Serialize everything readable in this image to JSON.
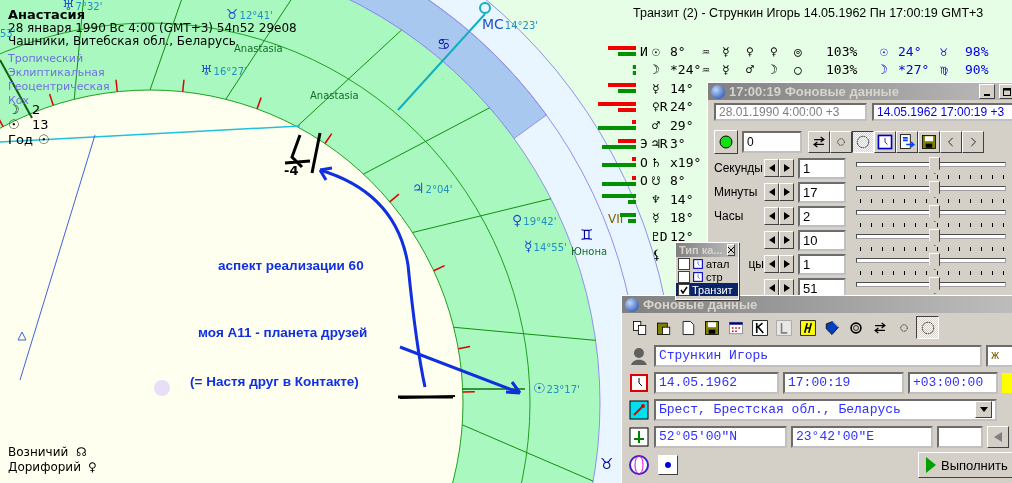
{
  "chart": {
    "header": {
      "name": "Анастасия",
      "date_line": "28 января 1990  Вс   4:00 (GMT+3) 54n52  29e08",
      "place": "Чашники, Витебская обл., Беларусь"
    },
    "settings": [
      "Тропический",
      "Эклиптикальная",
      "Геоцентрическая",
      "Кох"
    ],
    "indicators": [
      {
        "symbol": "☽",
        "value": "2"
      },
      {
        "symbol": "☉",
        "value": "13"
      },
      {
        "symbol": "Год",
        "value": "☉"
      }
    ],
    "labels": [
      {
        "kind": "degree",
        "text": "53'"
      },
      {
        "kind": "planet",
        "symbol": "♅",
        "text": "7°32'"
      },
      {
        "kind": "planet",
        "symbol": "♉",
        "text": "12°41'"
      },
      {
        "kind": "planet",
        "symbol": "♅",
        "text": "16°27'"
      },
      {
        "kind": "name",
        "text": "Anastasia"
      },
      {
        "kind": "name",
        "text": "Anastasia"
      },
      {
        "kind": "planet",
        "symbol": "MC",
        "text": "14°23'"
      },
      {
        "kind": "sign",
        "symbol": "♋"
      },
      {
        "kind": "planet",
        "symbol": "♃",
        "text": "2°04'"
      },
      {
        "kind": "planet",
        "symbol": "♀",
        "text": "19°42'"
      },
      {
        "kind": "planet",
        "symbol": "☿",
        "text": "14°55'"
      },
      {
        "kind": "sign",
        "symbol": "♊"
      },
      {
        "kind": "name",
        "text": "Юнона"
      },
      {
        "kind": "planet",
        "symbol": "☉",
        "text": "23°17'"
      },
      {
        "kind": "sign",
        "symbol": "♉"
      },
      {
        "kind": "house",
        "text": "VII"
      }
    ],
    "stars": [
      {
        "name": "Возничий",
        "symbol": "☊"
      },
      {
        "name": "Дорифорий",
        "symbol": "♀"
      }
    ],
    "annotations": [
      "аспект реализации 60",
      "моя А11 - планета друзей",
      "(= Настя  друг в Контакте)",
      "-4"
    ]
  },
  "transit": {
    "title": "Транзит (2) - Стрункин Игорь 14.05.1962  Пн 17:00:19 GMT+3",
    "rows": [
      {
        "bars": [
          {
            "kind": "red",
            "level": 0.7
          },
          {
            "kind": "green",
            "level": 0.45
          }
        ],
        "cells": [
          "И",
          "☉",
          "8°",
          "♒",
          "☿",
          "♀",
          "♀",
          "◎",
          "103%",
          "☉",
          "24°",
          "♉",
          "98%"
        ]
      },
      {
        "bars": [
          {
            "kind": "green",
            "level": 0.08
          },
          {
            "kind": "green",
            "level": 0.08
          }
        ],
        "cells": [
          "",
          "☽",
          "*24°",
          "♒",
          "☿",
          "♂",
          "☽",
          "○",
          "103%",
          "☽",
          "*27°",
          "♍",
          "90%"
        ]
      },
      {
        "bars": [
          {
            "kind": "red",
            "level": 0.7
          },
          {
            "kind": "green",
            "level": 0.45
          }
        ],
        "cells": [
          "",
          "☿",
          "14°"
        ]
      },
      {
        "bars": [
          {
            "kind": "red",
            "level": 0.95
          },
          {
            "kind": "red",
            "level": 0.45
          }
        ],
        "cells": [
          "",
          "♀R",
          "24°"
        ]
      },
      {
        "bars": [
          {
            "kind": "red",
            "level": 0.1
          },
          {
            "kind": "green",
            "level": 0.95
          }
        ],
        "cells": [
          "",
          "♂",
          "29°"
        ]
      },
      {
        "bars": [
          {
            "kind": "red",
            "level": 0.45
          },
          {
            "kind": "green",
            "level": 0.85
          }
        ],
        "cells": [
          "Э",
          "♃R",
          "3°"
        ]
      },
      {
        "bars": [
          {
            "kind": "red",
            "level": 0.1
          },
          {
            "kind": "green",
            "level": 0.85
          }
        ],
        "cells": [
          "О",
          "♄",
          "x19°"
        ]
      },
      {
        "bars": [
          {
            "kind": "red",
            "level": 0.1
          },
          {
            "kind": "green",
            "level": 0.85
          }
        ],
        "cells": [
          "О",
          "☋",
          "8°"
        ]
      },
      {
        "bars": [
          {
            "kind": "green",
            "level": 0.85
          },
          {
            "kind": "green",
            "level": 0.2
          }
        ],
        "cells": [
          "",
          "♆",
          "14°"
        ]
      },
      {
        "bars": [
          {
            "kind": "green",
            "level": 0.4
          },
          {
            "kind": "green",
            "level": 0.2
          }
        ],
        "cells": [
          "",
          "☿",
          "18°"
        ]
      },
      {
        "bars": [],
        "cells": [
          "",
          "♇D",
          "12°"
        ]
      },
      {
        "bars": [],
        "cells": [
          "",
          "⚸"
        ]
      }
    ]
  },
  "window_timer": {
    "title": "17:00:19 Фоновые данные",
    "date_natal": "28.01.1990   4:00:00  +3",
    "date_transit": "14.05.1962   17:00:19  +3",
    "step": "0",
    "tools": [
      {
        "kind": "swap",
        "selected": false
      },
      {
        "kind": "dot",
        "selected": false
      },
      {
        "kind": "circle",
        "selected": true
      },
      {
        "kind": "clock",
        "selected": false
      },
      {
        "kind": "export",
        "selected": false
      },
      {
        "kind": "save",
        "selected": false
      },
      {
        "kind": "prev",
        "selected": false
      },
      {
        "kind": "next",
        "selected": false
      }
    ],
    "sliders": [
      {
        "label": "Секунды",
        "value": "1",
        "level": 0.52
      },
      {
        "label": "Минуты",
        "value": "17",
        "level": 0.52
      },
      {
        "label": "Часы",
        "value": "2",
        "level": 0.52
      },
      {
        "value": "10",
        "level": 0.52
      },
      {
        "label": "цы",
        "kind": "partial",
        "value": "1",
        "level": 0.52
      },
      {
        "value": "51",
        "level": 0.52
      }
    ]
  },
  "window_type": {
    "title": "Тип ка...",
    "items": [
      {
        "label": "атал",
        "checked": false,
        "icon": true,
        "selected": false
      },
      {
        "label": "стр",
        "checked": false,
        "icon": true,
        "selected": false
      },
      {
        "label": "Транзит",
        "checked": true,
        "icon": false,
        "selected": true
      }
    ]
  },
  "window_data": {
    "title": "Фоновые данные",
    "tools": [
      {
        "kind": "copy",
        "selected": false
      },
      {
        "kind": "paste",
        "selected": false
      },
      {
        "kind": "new",
        "selected": false
      },
      {
        "kind": "save",
        "selected": false
      },
      {
        "kind": "calendar",
        "selected": false
      },
      {
        "kind": "K",
        "selected": false
      },
      {
        "kind": "L",
        "selected": false
      },
      {
        "kind": "H",
        "selected": false
      },
      {
        "kind": "book",
        "selected": false
      },
      {
        "kind": "ring",
        "selected": false
      },
      {
        "kind": "swap",
        "selected": false
      },
      {
        "kind": "dot",
        "selected": false
      },
      {
        "kind": "circle",
        "selected": true
      }
    ],
    "name": "Стрункин Игорь",
    "gender": "ж",
    "date": "14.05.1962",
    "time": "17:00:19",
    "zone": "+03:00:00",
    "place": "Брест, Брестская обл., Беларусь",
    "latitude": "52°05'00\"N",
    "longitude": "23°42'00\"E",
    "run_button": "Выполнить"
  }
}
